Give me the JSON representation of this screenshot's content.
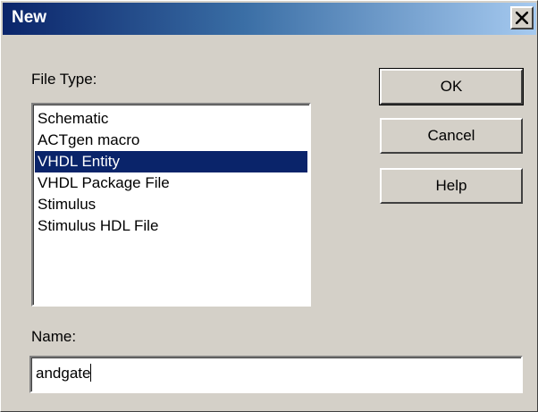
{
  "window": {
    "title": "New"
  },
  "labels": {
    "file_type": "File Type:",
    "name": "Name:"
  },
  "file_types": [
    {
      "label": "Schematic",
      "selected": false
    },
    {
      "label": "ACTgen macro",
      "selected": false
    },
    {
      "label": "VHDL Entity",
      "selected": true
    },
    {
      "label": "VHDL Package File",
      "selected": false
    },
    {
      "label": "Stimulus",
      "selected": false
    },
    {
      "label": "Stimulus HDL File",
      "selected": false
    }
  ],
  "buttons": {
    "ok": "OK",
    "cancel": "Cancel",
    "help": "Help"
  },
  "name_field": {
    "value": "andgate"
  },
  "colors": {
    "title_start": "#0a246a",
    "title_end": "#a6caf0",
    "selection": "#0a246a",
    "face": "#d4d0c8"
  },
  "icons": {
    "close": "close-icon"
  }
}
